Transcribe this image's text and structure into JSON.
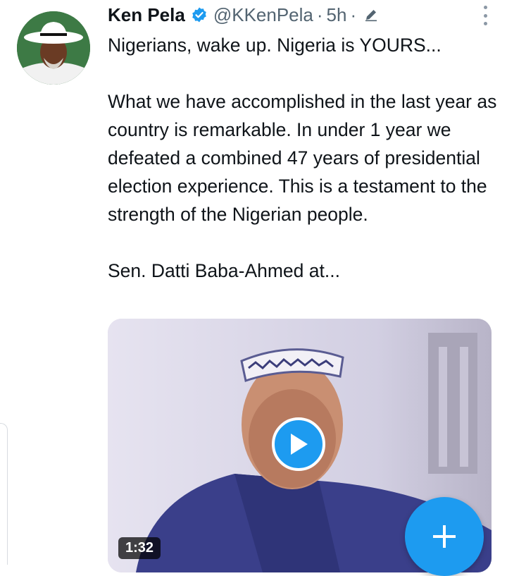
{
  "tweet": {
    "author_name": "Ken Pela",
    "handle": "@KKenPela",
    "separator": "·",
    "time": "5h",
    "separator2": "·",
    "text_lines": [
      "Nigerians, wake up. Nigeria is YOURS...",
      "What we have accomplished in the last year as country is remarkable. In under 1 year we defeated a combined 47 years of presidential election experience. This is a testament to the strength of the Nigerian people.",
      "Sen. Datti Baba-Ahmed at..."
    ],
    "verified_icon": "verified-badge-icon",
    "edit_icon": "edit-pencil-icon",
    "more_icon": "more-vertical-icon"
  },
  "media": {
    "type": "video",
    "duration": "1:32",
    "play_icon": "play-icon"
  },
  "compose_button": {
    "icon": "plus-icon"
  },
  "colors": {
    "accent": "#1d9bf0",
    "text": "#0f1419",
    "secondary_text": "#536471"
  }
}
